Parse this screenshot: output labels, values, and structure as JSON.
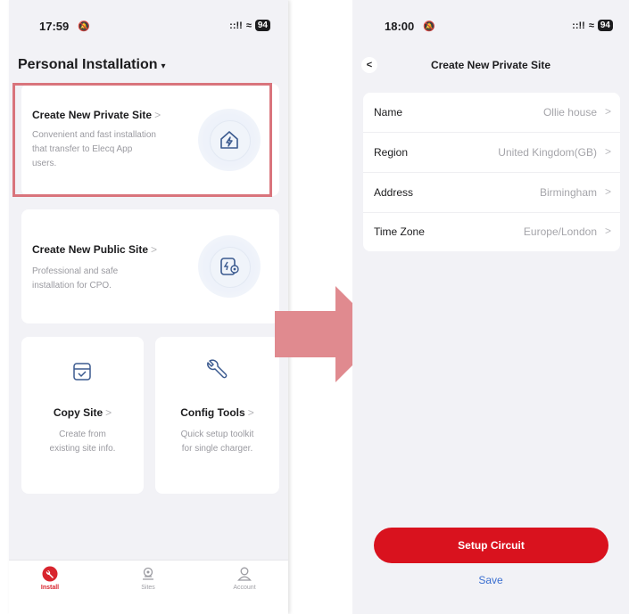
{
  "left_screen": {
    "status": {
      "time": "17:59",
      "signal": "::!!",
      "wifi": "≈",
      "battery": "94"
    },
    "header": {
      "title": "Personal Installation",
      "caret": "▾"
    },
    "cards": [
      {
        "title": "Create New Private Site",
        "chevron": ">",
        "description": [
          "Convenient and fast installation",
          "that transfer to Elecq App",
          "users."
        ],
        "icon": "house-lightning-icon"
      },
      {
        "title": "Create New Public Site",
        "chevron": ">",
        "description": [
          "Professional and safe",
          "installation for CPO."
        ],
        "icon": "charger-icon"
      },
      {
        "title": "Copy Site",
        "chevron": ">",
        "description": [
          "Create from",
          "existing site info."
        ],
        "icon": "copy-site-icon"
      },
      {
        "title": "Config Tools",
        "chevron": ">",
        "description": [
          "Quick setup toolkit",
          "for single charger."
        ],
        "icon": "wrench-icon"
      }
    ],
    "tabs": [
      {
        "label": "Install",
        "icon": "install-icon",
        "active": true
      },
      {
        "label": "Sites",
        "icon": "sites-icon",
        "active": false
      },
      {
        "label": "Account",
        "icon": "account-icon",
        "active": false
      }
    ]
  },
  "right_screen": {
    "status": {
      "time": "18:00",
      "signal": "::!!",
      "wifi": "≈",
      "battery": "94"
    },
    "nav": {
      "back": "<",
      "title": "Create New Private Site"
    },
    "fields": [
      {
        "label": "Name",
        "value": "Ollie house",
        "chevron": ">"
      },
      {
        "label": "Region",
        "value": "United Kingdom(GB)",
        "chevron": ">"
      },
      {
        "label": "Address",
        "value": "Birmingham",
        "chevron": ">"
      },
      {
        "label": "Time Zone",
        "value": "Europe/London",
        "chevron": ">"
      }
    ],
    "primary_button": "Setup Circuit",
    "secondary_button": "Save"
  },
  "colors": {
    "accent_red": "#d9121e",
    "highlight": "#d9747c",
    "arrow": "#e08a8f",
    "link_blue": "#3b6fd0"
  }
}
